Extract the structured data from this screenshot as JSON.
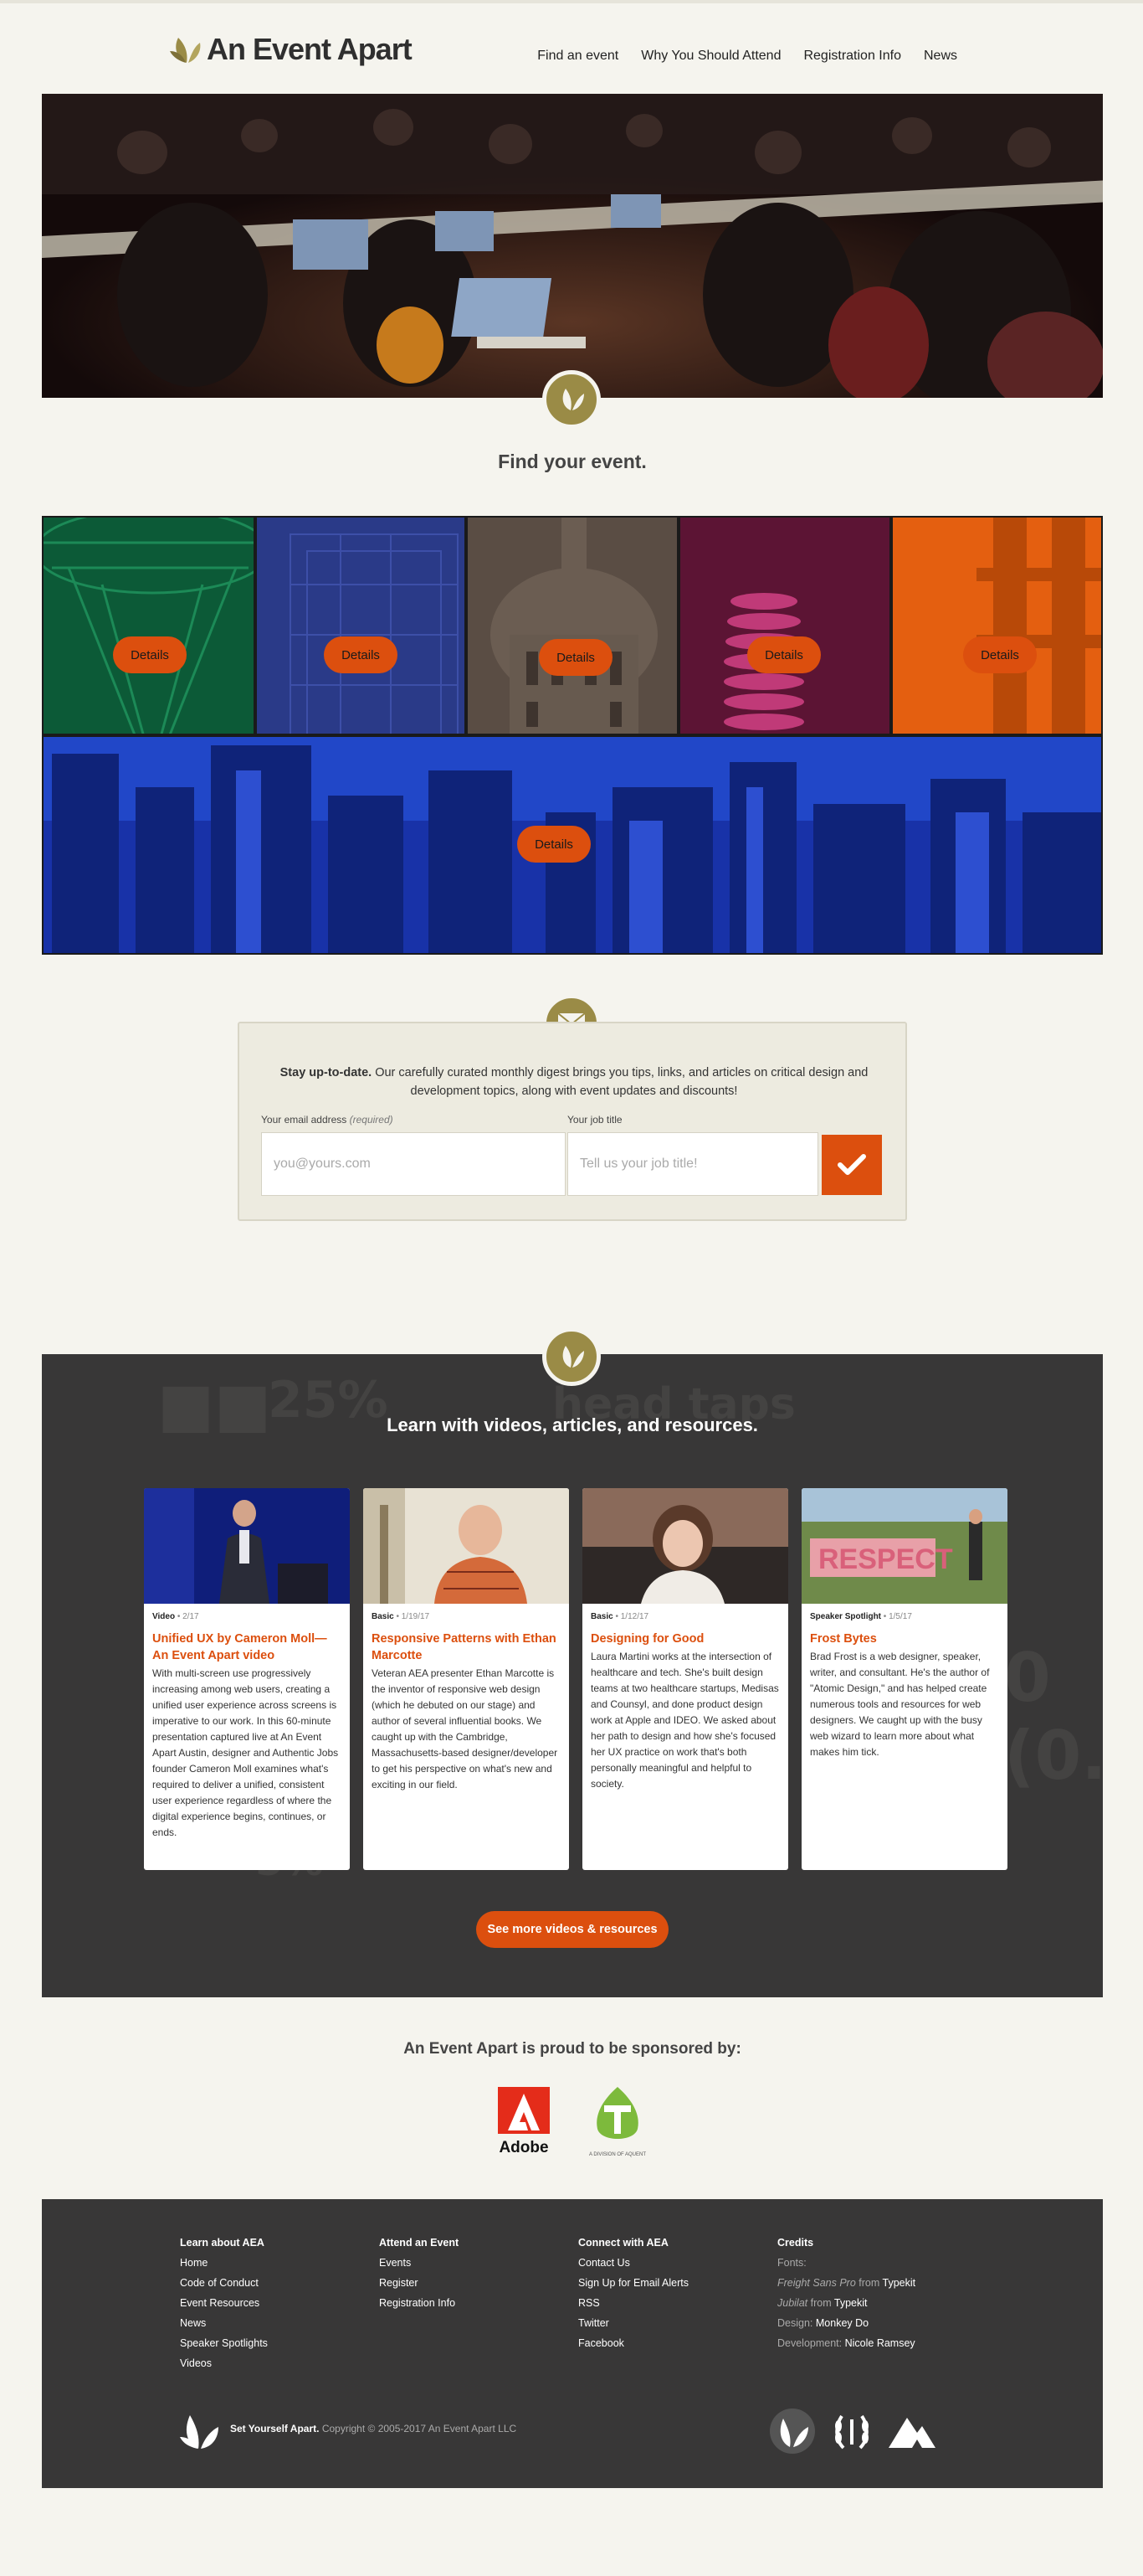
{
  "header": {
    "logo_text": "An Event Apart",
    "nav": [
      "Find an event",
      "Why You Should Attend",
      "Registration Info",
      "News"
    ]
  },
  "find": {
    "title": "Find your event.",
    "details_label": "Details"
  },
  "newsletter": {
    "lead": "Stay up-to-date.",
    "text": "Our carefully curated monthly digest brings you tips, links, and articles on critical design and development topics, along with event updates and discounts!",
    "email_label": "Your email address",
    "email_required": "(required)",
    "email_placeholder": "you@yours.com",
    "job_label": "Your job title",
    "job_placeholder": "Tell us your job title!"
  },
  "learn": {
    "title": "Learn with videos, articles, and resources.",
    "see_more": "See more videos & resources",
    "cards": [
      {
        "type": "Video",
        "date": "2/17",
        "title": "Unified UX by Cameron Moll—An Event Apart video",
        "text": "With multi-screen use progressively increasing among web users, creating a unified user experience across screens is imperative to our work. In this 60-minute presentation captured live at An Event Apart Austin, designer and Authentic Jobs founder Cameron Moll examines what's required to deliver a unified, consistent user experience regardless of where the digital experience begins, continues, or ends."
      },
      {
        "type": "Basic",
        "date": "1/19/17",
        "title": "Responsive Patterns with Ethan Marcotte",
        "text": "Veteran AEA presenter Ethan Marcotte is the inventor of responsive web design (which he debuted on our stage) and author of several influential books. We caught up with the Cambridge, Massachusetts-based designer/developer to get his perspective on what's new and exciting in our field."
      },
      {
        "type": "Basic",
        "date": "1/12/17",
        "title": "Designing for Good",
        "text": "Laura Martini works at the intersection of healthcare and tech. She's built design teams at two healthcare startups, Medisas and Counsyl, and done product design work at Apple and IDEO. We asked about her path to design and how she's focused her UX practice on work that's both personally meaningful and helpful to society."
      },
      {
        "type": "Speaker Spotlight",
        "date": "1/5/17",
        "title": "Frost Bytes",
        "text": "Brad Frost is a web designer, speaker, writer, and consultant. He's the author of \"Atomic Design,\" and has helped create numerous tools and resources for web designers. We caught up with the busy web wizard to learn more about what makes him tick."
      }
    ],
    "bg_numerals": [
      "25%",
      "5%",
      "0 (0."
    ],
    "bg_words": "head taps"
  },
  "sponsors": {
    "title": "An Event Apart is proud to be sponsored by:",
    "adobe": "Adobe",
    "treehouse_tagline": "A DIVISION OF AQUENT"
  },
  "footer": {
    "learn": {
      "title": "Learn about AEA",
      "links": [
        "Home",
        "Code of Conduct",
        "Event Resources",
        "News",
        "Speaker Spotlights",
        "Videos"
      ]
    },
    "attend": {
      "title": "Attend an Event",
      "links": [
        "Events",
        "Register",
        "Registration Info"
      ]
    },
    "connect": {
      "title": "Connect with AEA",
      "links": [
        "Contact Us",
        "Sign Up for Email Alerts",
        "RSS",
        "Twitter",
        "Facebook"
      ]
    },
    "credits": {
      "title": "Credits",
      "fonts": "Fonts:",
      "font1_name": "Freight Sans Pro",
      "font1_from": "from",
      "font1_src": "Typekit",
      "font2_name": "Jubilat",
      "font2_from": "from",
      "font2_src": "Typekit",
      "design_label": "Design:",
      "design": "Monkey Do",
      "dev_label": "Development:",
      "dev": "Nicole Ramsey"
    },
    "tagline": "Set Yourself Apart.",
    "copyright": "Copyright © 2005-2017 An Event Apart LLC"
  },
  "colors": {
    "accent": "#dc4f0e",
    "olive": "#9a8b46",
    "dark": "#383737",
    "cream": "#f5f4ee"
  }
}
